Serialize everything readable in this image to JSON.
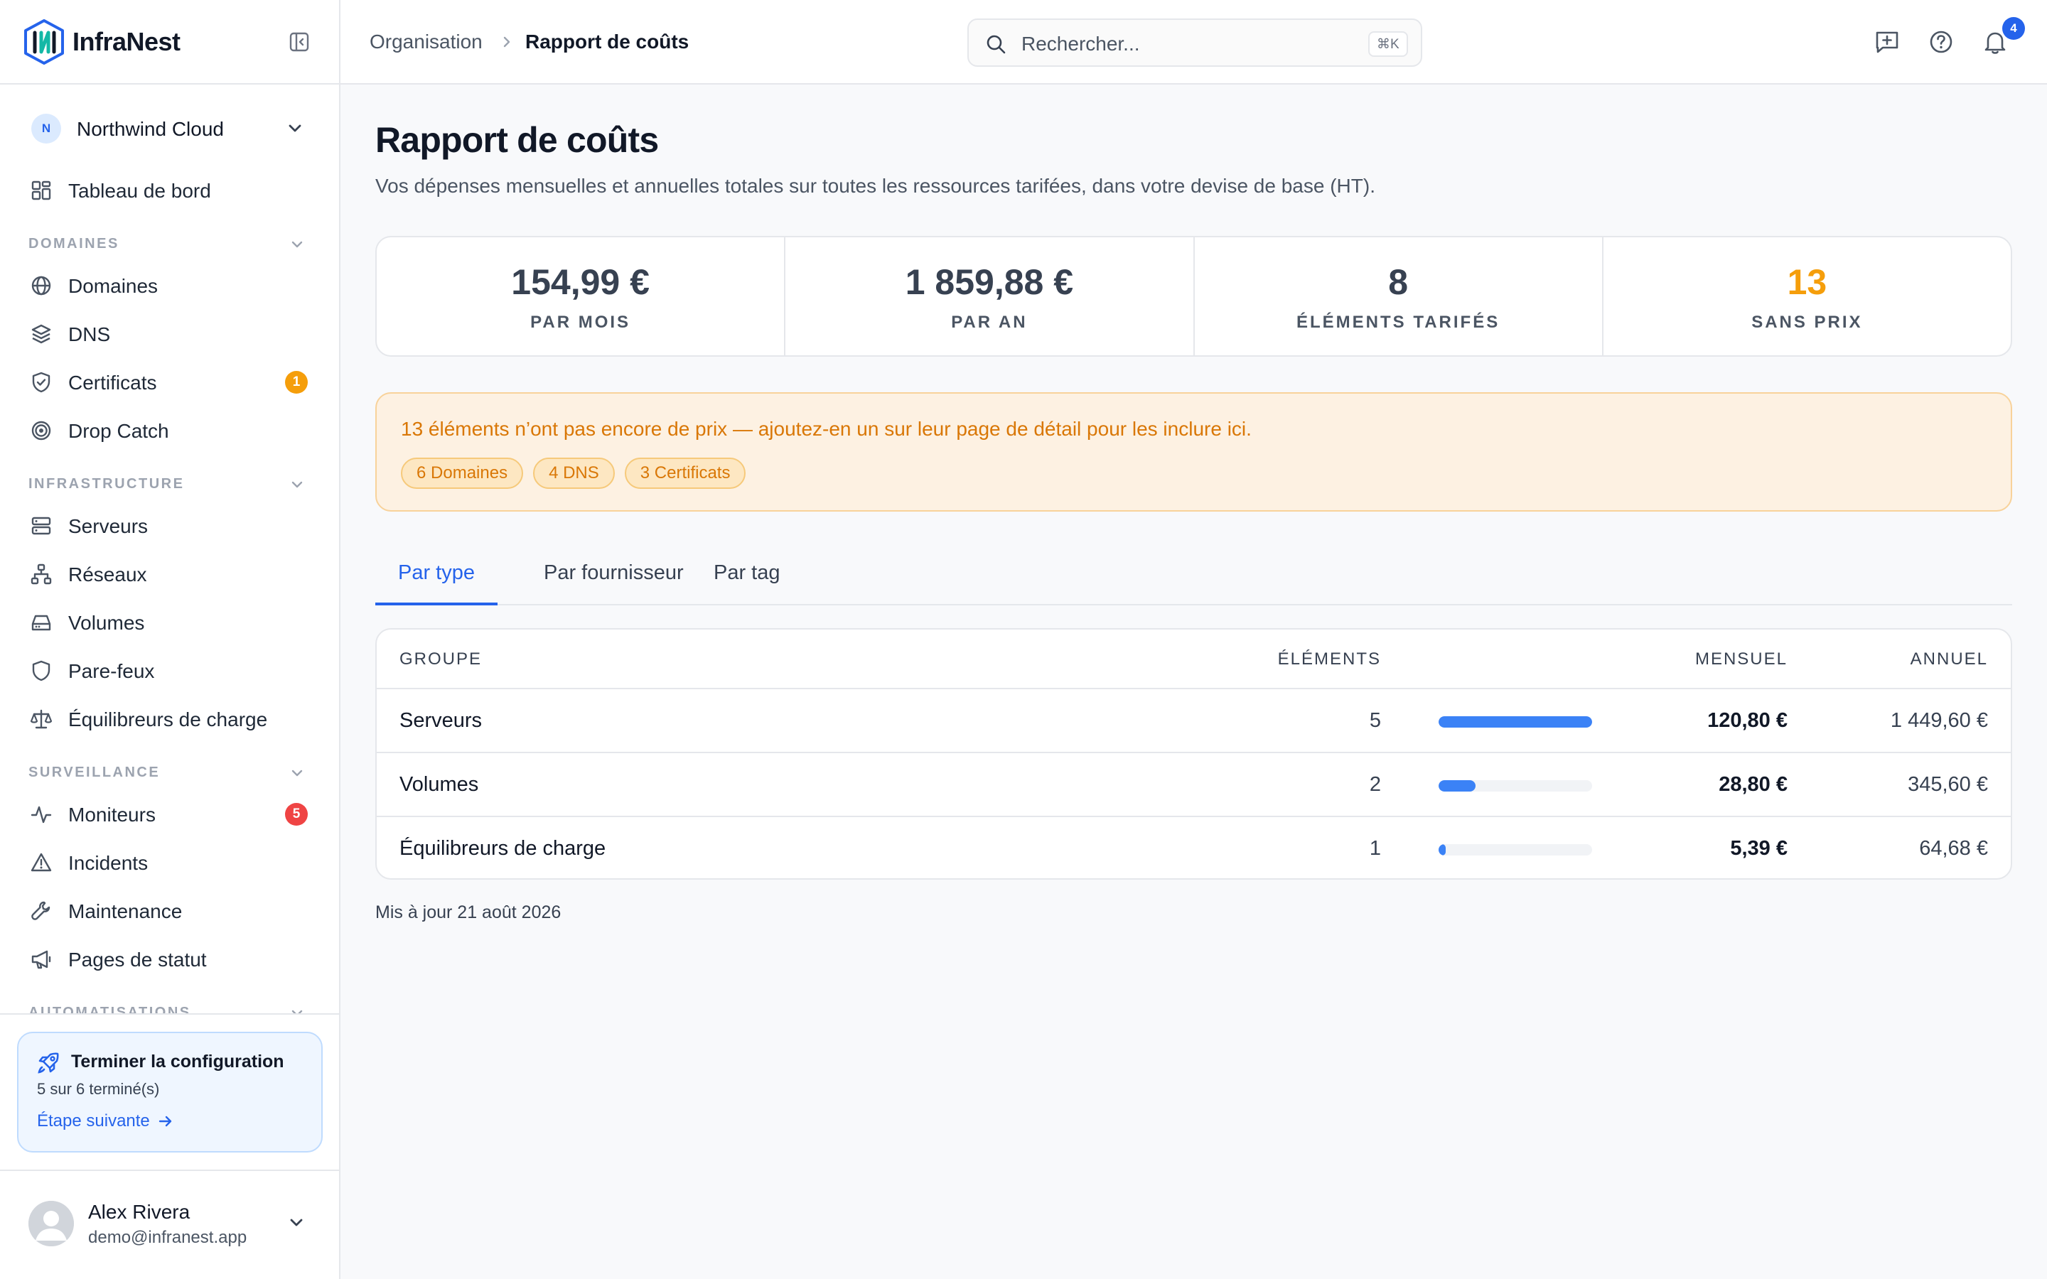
{
  "brand": {
    "name": "InfraNest"
  },
  "org": {
    "initial": "N",
    "name": "Northwind Cloud"
  },
  "nav": {
    "dashboard": "Tableau de bord",
    "sections": [
      {
        "label": "DOMAINES"
      },
      {
        "label": "INFRASTRUCTURE"
      },
      {
        "label": "SURVEILLANCE"
      },
      {
        "label": "AUTOMATISATIONS"
      }
    ],
    "items": {
      "domains": "Domaines",
      "dns": "DNS",
      "certificates": "Certificats",
      "certificates_badge": "1",
      "drop_catch": "Drop Catch",
      "servers": "Serveurs",
      "networks": "Réseaux",
      "volumes": "Volumes",
      "firewalls": "Pare-feux",
      "load_balancers": "Équilibreurs de charge",
      "monitors": "Moniteurs",
      "monitors_badge": "5",
      "incidents": "Incidents",
      "maintenance": "Maintenance",
      "status_pages": "Pages de statut"
    }
  },
  "setup": {
    "title": "Terminer la configuration",
    "progress": "5 sur 6 terminé(s)",
    "next": "Étape suivante"
  },
  "user": {
    "name": "Alex Rivera",
    "email": "demo@infranest.app"
  },
  "breadcrumb": {
    "parent": "Organisation",
    "current": "Rapport de coûts"
  },
  "search": {
    "placeholder": "Rechercher...",
    "shortcut": "⌘K"
  },
  "notifications": {
    "count": "4"
  },
  "page": {
    "title": "Rapport de coûts",
    "subtitle": "Vos dépenses mensuelles et annuelles totales sur toutes les ressources tarifées, dans votre devise de base (HT)."
  },
  "stats": [
    {
      "value": "154,99 €",
      "label": "PAR MOIS"
    },
    {
      "value": "1 859,88 €",
      "label": "PAR AN"
    },
    {
      "value": "8",
      "label": "ÉLÉMENTS TARIFÉS"
    },
    {
      "value": "13",
      "label": "SANS PRIX"
    }
  ],
  "alert": {
    "text": "13 éléments n’ont pas encore de prix — ajoutez-en un sur leur page de détail pour les inclure ici.",
    "chips": [
      "6 Domaines",
      "4 DNS",
      "3 Certificats"
    ]
  },
  "tabs": [
    "Par type",
    "Par fournisseur",
    "Par tag"
  ],
  "table": {
    "headers": {
      "group": "GROUPE",
      "items": "ÉLÉMENTS",
      "monthly": "MENSUEL",
      "annual": "ANNUEL"
    },
    "rows": [
      {
        "group": "Serveurs",
        "items": "5",
        "share": 1.0,
        "monthly": "120,80 €",
        "annual": "1 449,60 €"
      },
      {
        "group": "Volumes",
        "items": "2",
        "share": 0.24,
        "monthly": "28,80 €",
        "annual": "345,60 €"
      },
      {
        "group": "Équilibreurs de charge",
        "items": "1",
        "share": 0.045,
        "monthly": "5,39 €",
        "annual": "64,68 €"
      }
    ]
  },
  "footer": {
    "updated": "Mis à jour 21 août 2026"
  },
  "colors": {
    "accent": "#2563eb",
    "bar": "#3b82f6",
    "warning": "#d97706",
    "unpriced": "#f59e0b",
    "badge_warning": "#f59e0b",
    "badge_danger": "#ef4444"
  }
}
